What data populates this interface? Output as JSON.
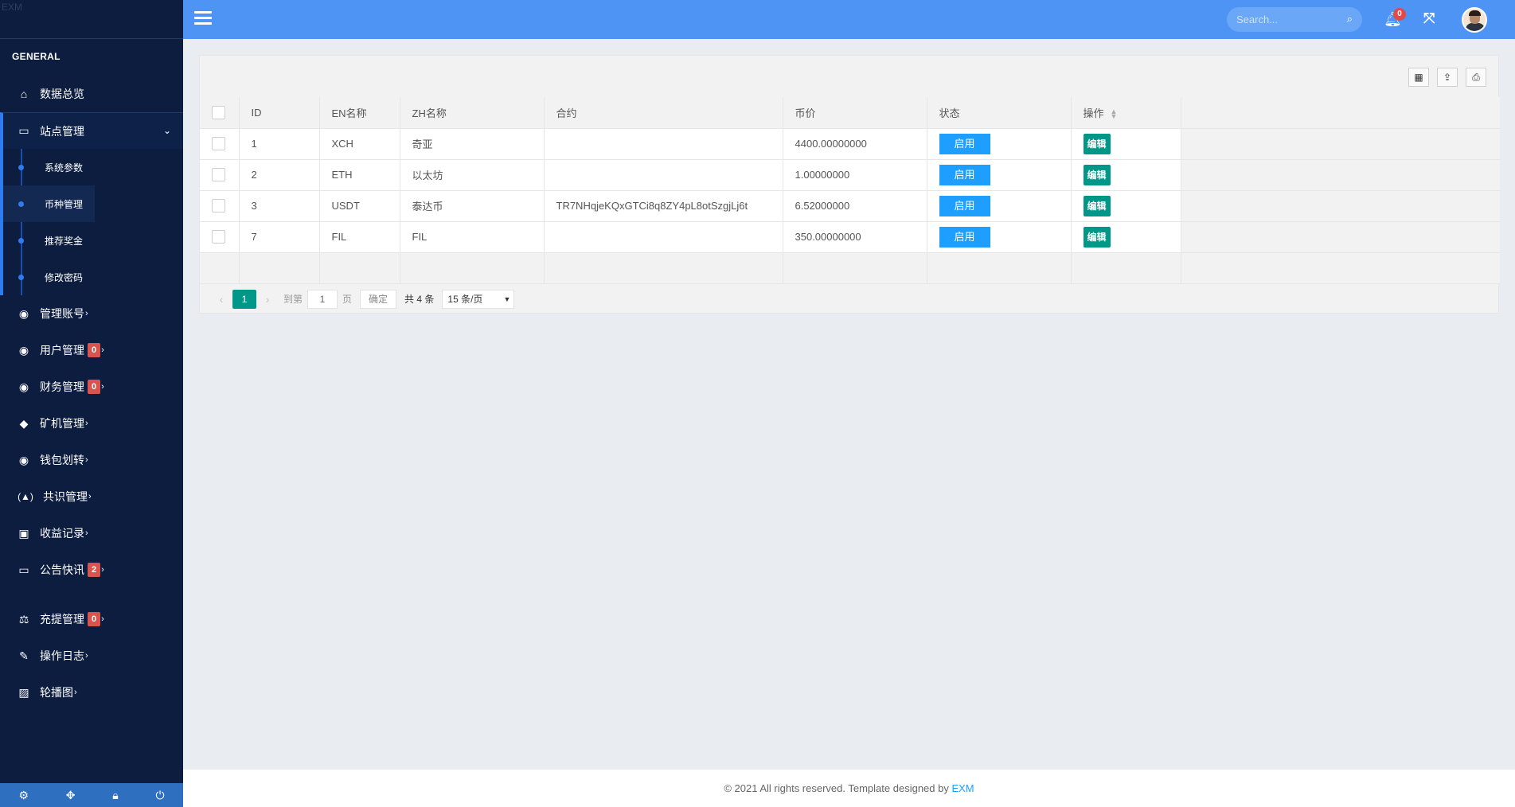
{
  "brand": {
    "text": "EXM"
  },
  "sidebar": {
    "section_title": "GENERAL",
    "overview": {
      "label": "数据总览"
    },
    "site_mgmt": {
      "label": "站点管理"
    },
    "submenu": [
      {
        "label": "系统参数"
      },
      {
        "label": "币种管理"
      },
      {
        "label": "推荐奖金"
      },
      {
        "label": "修改密码"
      }
    ],
    "items": [
      {
        "label": "管理账号"
      },
      {
        "label": "用户管理",
        "badge": "0"
      },
      {
        "label": "财务管理",
        "badge": "0"
      },
      {
        "label": "矿机管理"
      },
      {
        "label": "钱包划转"
      },
      {
        "label": "共识管理"
      },
      {
        "label": "收益记录"
      },
      {
        "label": "公告快讯",
        "badge": "2"
      },
      {
        "label": "充提管理",
        "badge": "0"
      },
      {
        "label": "操作日志"
      },
      {
        "label": "轮播图"
      }
    ]
  },
  "topbar": {
    "search_placeholder": "Search...",
    "notification_count": "0"
  },
  "table": {
    "headers": {
      "id": "ID",
      "en": "EN名称",
      "zh": "ZH名称",
      "contract": "合约",
      "price": "币价",
      "status": "状态",
      "action": "操作"
    },
    "rows": [
      {
        "id": "1",
        "en": "XCH",
        "zh": "奇亚",
        "contract": "",
        "price": "4400.00000000",
        "status": "启用",
        "action": "编辑"
      },
      {
        "id": "2",
        "en": "ETH",
        "zh": "以太坊",
        "contract": "",
        "price": "1.00000000",
        "status": "启用",
        "action": "编辑"
      },
      {
        "id": "3",
        "en": "USDT",
        "zh": "泰达币",
        "contract": "TR7NHqjeKQxGTCi8q8ZY4pL8otSzgjLj6t",
        "price": "6.52000000",
        "status": "启用",
        "action": "编辑"
      },
      {
        "id": "7",
        "en": "FIL",
        "zh": "FIL",
        "contract": "",
        "price": "350.00000000",
        "status": "启用",
        "action": "编辑"
      }
    ]
  },
  "pager": {
    "current": "1",
    "goto_label": "到第",
    "goto_value": "1",
    "page_suffix": "页",
    "confirm": "确定",
    "total": "共 4 条",
    "page_size": "15 条/页"
  },
  "footer": {
    "text": "© 2021 All rights reserved. Template designed by ",
    "link": "EXM"
  }
}
